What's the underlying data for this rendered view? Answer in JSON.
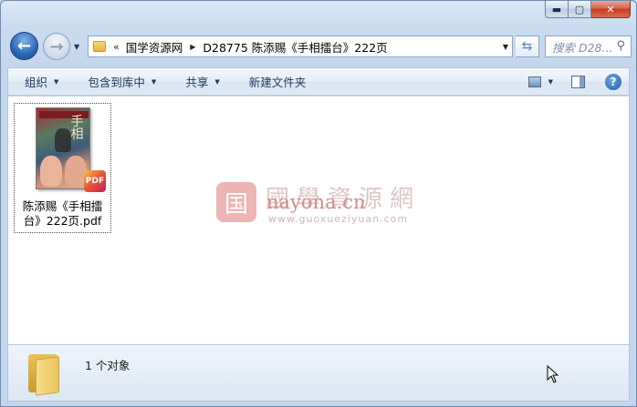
{
  "window": {
    "caption": {
      "minimize_glyph": "▬",
      "maximize_glyph": "▢",
      "close_glyph": "✕"
    }
  },
  "nav": {
    "back_glyph": "←",
    "forward_glyph": "→",
    "dropdown_glyph": "▼",
    "address": {
      "overflow_glyph": "«",
      "breadcrumbs": [
        "国学资源网",
        "D28775 陈添赐《手相擂台》222页"
      ],
      "separator_glyph": "▶",
      "dropdown_glyph": "▼"
    },
    "refresh_glyph": "⇆",
    "search_placeholder": "搜索 D28...",
    "search_icon_glyph": "⚲"
  },
  "toolbar": {
    "items": [
      {
        "label": "组织",
        "has_caret": true
      },
      {
        "label": "包含到库中",
        "has_caret": true
      },
      {
        "label": "共享",
        "has_caret": true
      },
      {
        "label": "新建文件夹",
        "has_caret": false
      }
    ],
    "caret_glyph": "▼",
    "help_glyph": "?"
  },
  "files": [
    {
      "name": "陈添赐《手相擂台》222页.pdf",
      "thumbnail_title_glyphs": "手相",
      "badge_label": "PDF"
    }
  ],
  "watermark": {
    "seal_glyph": "国",
    "chinese": "國學資源網",
    "english": "nayona.cn",
    "url": "www.guoxueziyuan.com"
  },
  "status": {
    "text": "1 个对象"
  },
  "colors": {
    "close_button": "#c33b1c",
    "accent": "#1f5ea8",
    "pdf_badge": "#e75432"
  }
}
